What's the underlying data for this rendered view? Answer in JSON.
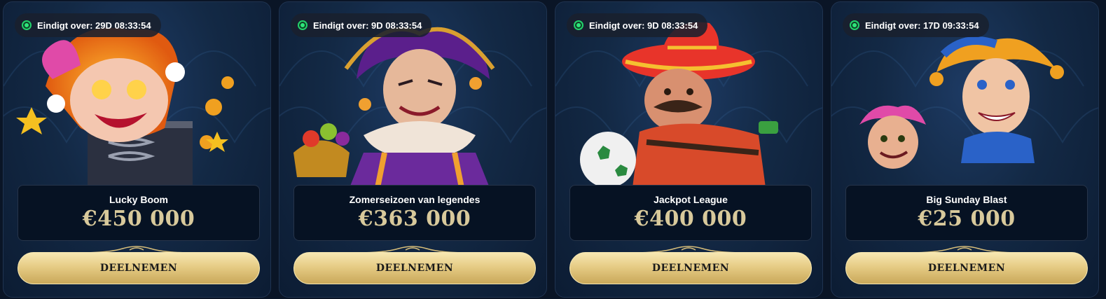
{
  "colors": {
    "live": "#23d26b",
    "amount": "#d8c99b",
    "button": "#e6cc85",
    "panel": "#061223"
  },
  "tournaments": [
    {
      "timer": "Eindigt over: 29D 08:33:54",
      "title": "Lucky Boom",
      "prize": "€450 000",
      "button": "DEELNEMEN",
      "art": "jester-in-box-image"
    },
    {
      "timer": "Eindigt over: 9D 08:33:54",
      "title": "Zomerseizoen van legendes",
      "prize": "€363 000",
      "button": "DEELNEMEN",
      "art": "purple-jester-image"
    },
    {
      "timer": "Eindigt over: 9D 08:33:54",
      "title": "Jackpot League",
      "prize": "€400 000",
      "button": "DEELNEMEN",
      "art": "sombrero-football-image"
    },
    {
      "timer": "Eindigt over: 17D 09:33:54",
      "title": "Big Sunday Blast",
      "prize": "€25 000",
      "button": "DEELNEMEN",
      "art": "twin-jesters-image"
    }
  ]
}
